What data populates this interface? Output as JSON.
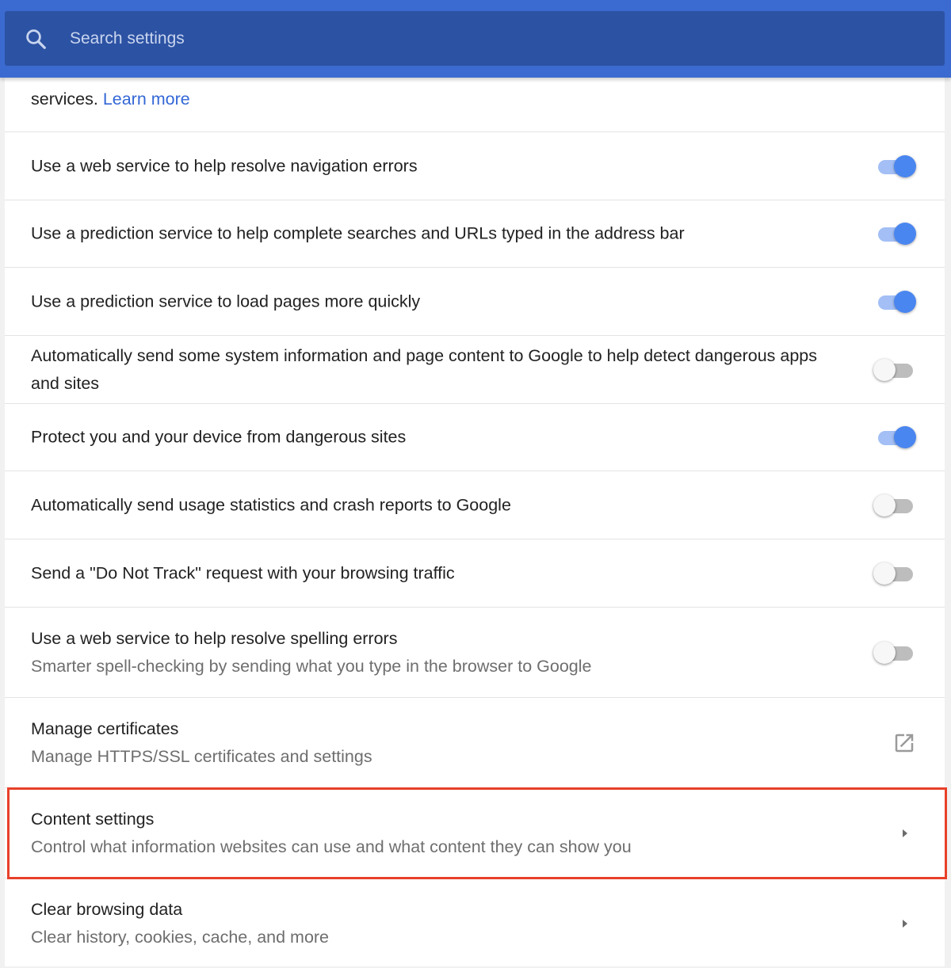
{
  "search": {
    "placeholder": "Search settings"
  },
  "intro": {
    "text": "services.",
    "link": "Learn more"
  },
  "rows": [
    {
      "primary": "Use a web service to help resolve navigation errors",
      "toggle": "on"
    },
    {
      "primary": "Use a prediction service to help complete searches and URLs typed in the address bar",
      "toggle": "on"
    },
    {
      "primary": "Use a prediction service to load pages more quickly",
      "toggle": "on"
    },
    {
      "primary": "Automatically send some system information and page content to Google to help detect dangerous apps and sites",
      "toggle": "off"
    },
    {
      "primary": "Protect you and your device from dangerous sites",
      "toggle": "on"
    },
    {
      "primary": "Automatically send usage statistics and crash reports to Google",
      "toggle": "off"
    },
    {
      "primary": "Send a \"Do Not Track\" request with your browsing traffic",
      "toggle": "off"
    },
    {
      "primary": "Use a web service to help resolve spelling errors",
      "secondary": "Smarter spell-checking by sending what you type in the browser to Google",
      "toggle": "off"
    },
    {
      "primary": "Manage certificates",
      "secondary": "Manage HTTPS/SSL certificates and settings",
      "action": "open-in-new-icon"
    },
    {
      "primary": "Content settings",
      "secondary": "Control what information websites can use and what content they can show you",
      "action": "chevron-right-icon"
    },
    {
      "primary": "Clear browsing data",
      "secondary": "Clear history, cookies, cache, and more",
      "action": "chevron-right-icon"
    }
  ],
  "colors": {
    "header": "#3b6bd0",
    "search_bar": "#2c52a3",
    "link": "#3367d6",
    "toggle_on": "#4a86f0",
    "highlight": "#e8402a"
  }
}
